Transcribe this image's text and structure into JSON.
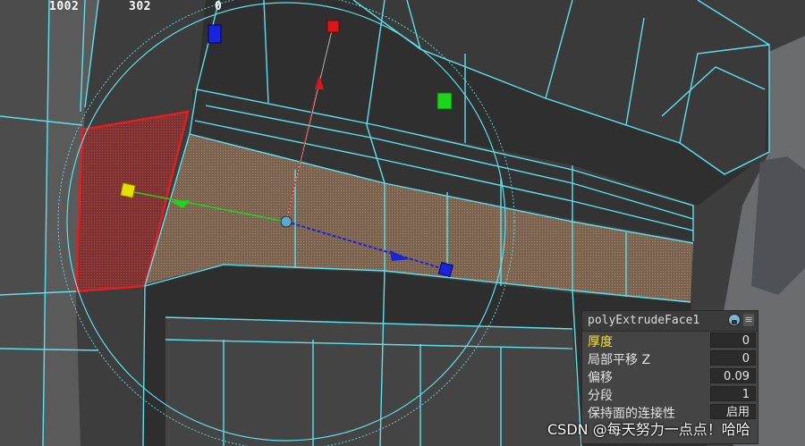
{
  "hud": {
    "vertices": "1002",
    "edges": "302",
    "faces": "0"
  },
  "channel_box": {
    "title": "polyExtrudeFace1",
    "menu_icon": "menu-icon",
    "node_icon": "node-icon",
    "rows": [
      {
        "label": "厚度",
        "value": "0",
        "highlighted": true
      },
      {
        "label": "局部平移 Z",
        "value": "0",
        "highlighted": false
      },
      {
        "label": "偏移",
        "value": "0.09",
        "highlighted": false
      },
      {
        "label": "分段",
        "value": "1",
        "highlighted": false
      },
      {
        "label": "保持面的连接性",
        "value": "启用",
        "highlighted": false
      }
    ]
  },
  "watermark": "CSDN @每天努力一点点！哈哈",
  "colors": {
    "wire": "#5ee0ef",
    "selected_face": "#e02020",
    "extruded_face": "#8a7058",
    "axis_x": "#1a24d8",
    "axis_y": "#d81818",
    "axis_z": "#1fd41f",
    "label_highlight": "#ffe600"
  }
}
